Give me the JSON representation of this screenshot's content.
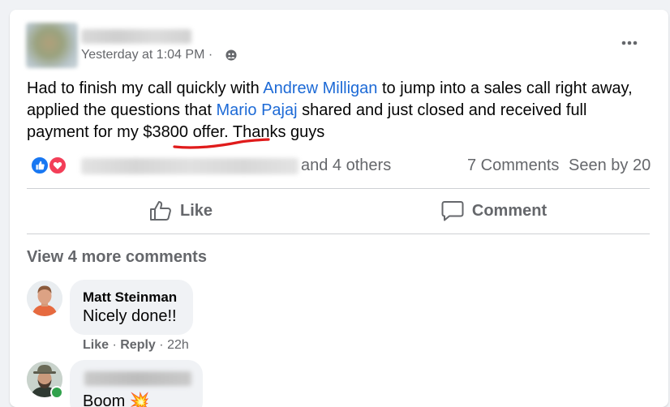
{
  "post": {
    "timestamp": "Yesterday at 1:04 PM · ",
    "text_part1": "Had to finish my call quickly with ",
    "mention1": "Andrew Milligan",
    "text_part2": " to jump into a sales call right away, applied the questions that  ",
    "mention2": "Mario Pajaj",
    "text_part3": " shared and just closed and received full payment for my ",
    "highlight": "$3800 offer.",
    "text_part4": "  Thanks guys"
  },
  "stats": {
    "and_others": "and 4 others",
    "comments": "7 Comments",
    "seen_by": "Seen by 20"
  },
  "actions": {
    "like": "Like",
    "comment": "Comment"
  },
  "comments_section": {
    "view_more": "View 4 more comments",
    "comments": [
      {
        "author": "Matt Steinman",
        "text": "Nicely done!!",
        "like": "Like",
        "reply": "Reply",
        "time": "22h"
      },
      {
        "text": "Boom 💥"
      }
    ]
  },
  "icons": {
    "privacy": "friends-icon",
    "more": "more-options-icon",
    "like_reaction": "like-reaction-icon",
    "love_reaction": "love-reaction-icon"
  },
  "colors": {
    "mention": "#1d6ad6",
    "annotation": "#e01b1b",
    "like_blue": "#1877f2",
    "love_red": "#f33e58",
    "secondary_text": "#65676b"
  }
}
